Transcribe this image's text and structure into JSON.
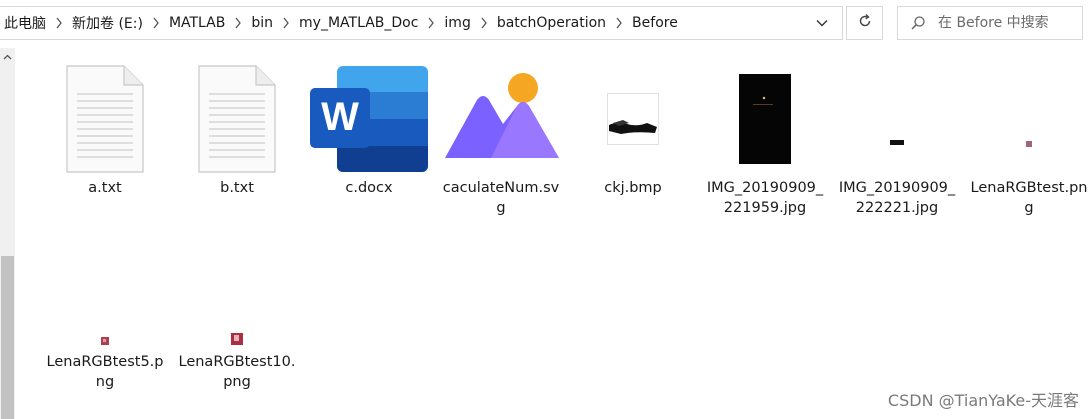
{
  "address_bar": {
    "crumbs": [
      "此电脑",
      "新加卷 (E:)",
      "MATLAB",
      "bin",
      "my_MATLAB_Doc",
      "img",
      "batchOperation",
      "Before"
    ]
  },
  "search": {
    "placeholder": "在 Before 中搜索"
  },
  "files": [
    {
      "name": "a.txt",
      "icon": "text-document-icon"
    },
    {
      "name": "b.txt",
      "icon": "text-document-icon"
    },
    {
      "name": "c.docx",
      "icon": "word-document-icon"
    },
    {
      "name": "caculateNum.svg",
      "icon": "svg-image-icon"
    },
    {
      "name": "ckj.bmp",
      "icon": "bmp-thumbnail-icon"
    },
    {
      "name": "IMG_20190909_221959.jpg",
      "icon": "jpg-thumbnail-icon"
    },
    {
      "name": "IMG_20190909_222221.jpg",
      "icon": "jpg-thumbnail-icon"
    },
    {
      "name": "LenaRGBtest.png",
      "icon": "png-thumbnail-icon"
    },
    {
      "name": "LenaRGBtest5.png",
      "icon": "png-thumbnail-icon"
    },
    {
      "name": "LenaRGBtest10.png",
      "icon": "png-thumbnail-icon"
    }
  ],
  "watermark": "CSDN @TianYaKe-天涯客",
  "colors": {
    "word_blue": "#185abd",
    "svg_purple": "#7b61ff",
    "svg_sun": "#f5a623",
    "scroll_thumb": "#c2c2c2"
  }
}
